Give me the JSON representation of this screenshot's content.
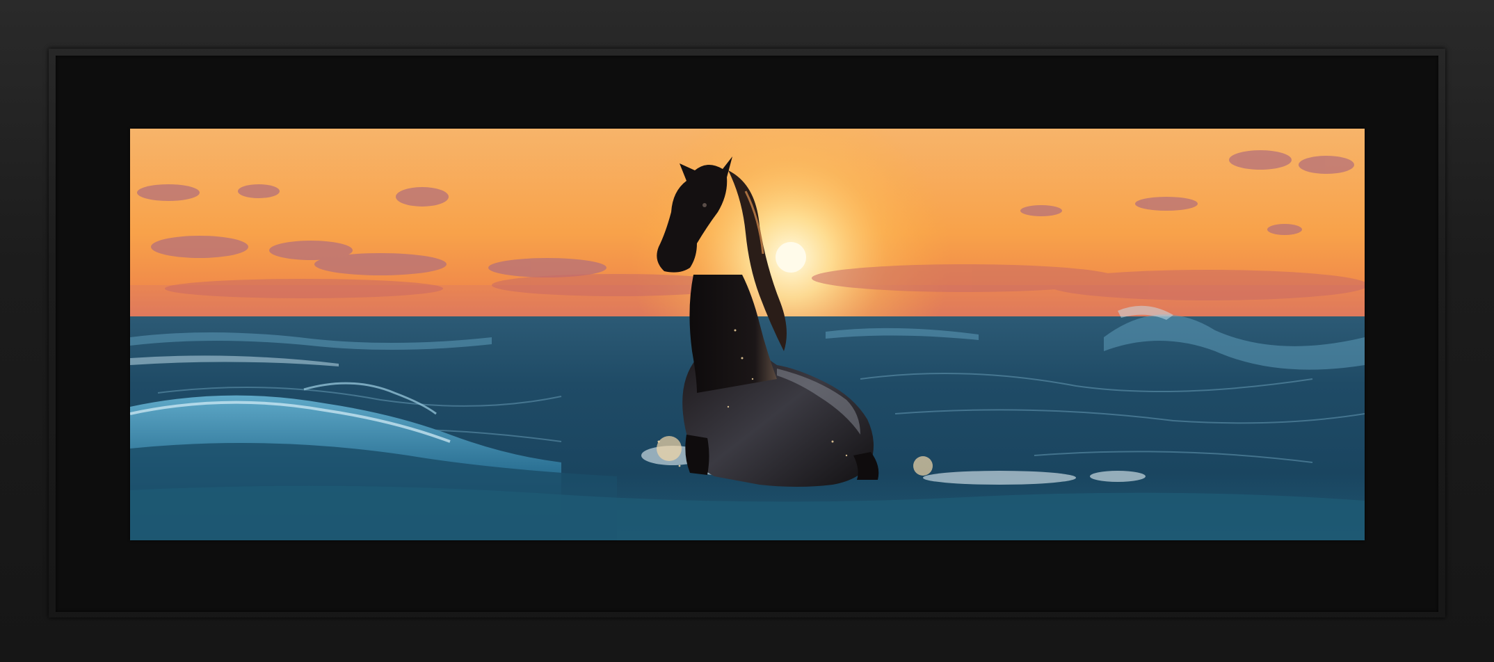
{
  "artwork": {
    "subject": "horse-in-ocean-at-sunset",
    "colors": {
      "frame": "#1c1c1c",
      "mat": "#0d0d0d",
      "sky_top": "#f6b26b",
      "sky_horizon": "#f27a3a",
      "sun": "#fff3c4",
      "sea_dark": "#12334a",
      "sea_light": "#3a7fa0",
      "horse": "#120f10"
    }
  }
}
